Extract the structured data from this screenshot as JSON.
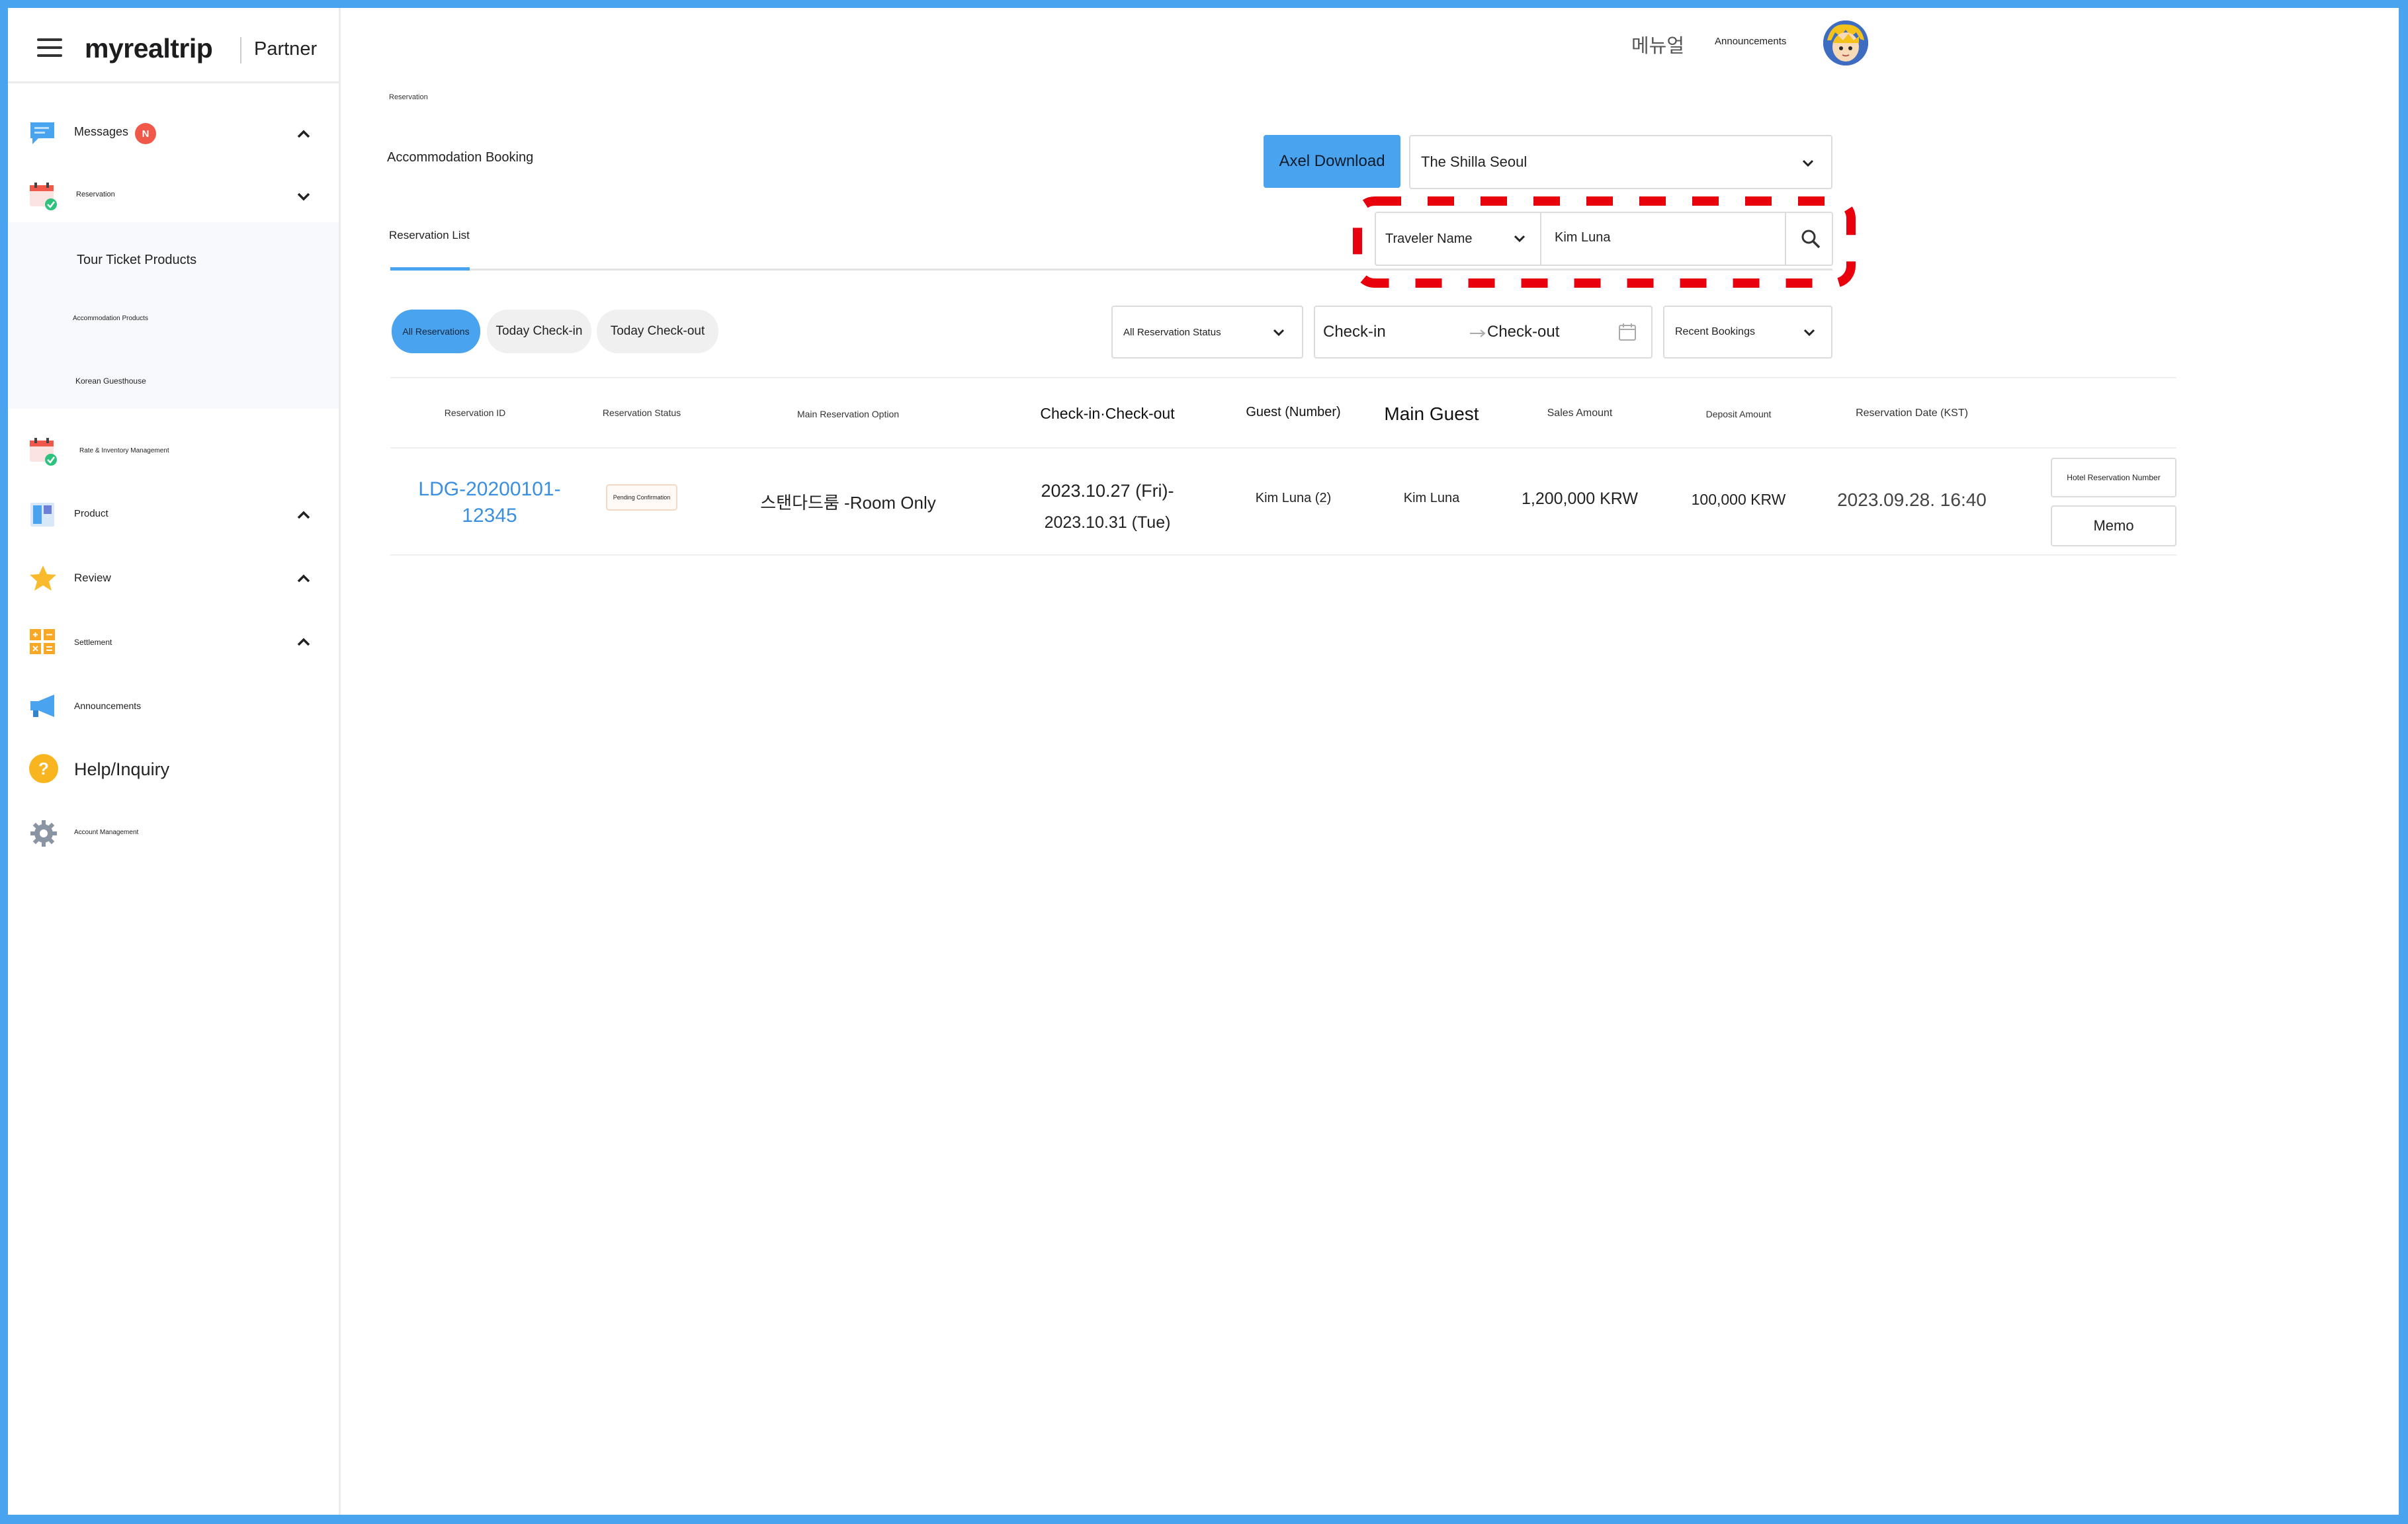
{
  "brand": {
    "logo": "myrealtrip",
    "section": "Partner"
  },
  "topbar": {
    "user_name": "메뉴얼",
    "announcements": "Announcements"
  },
  "sidebar": {
    "items": [
      {
        "label": "Messages",
        "badge": "N"
      },
      {
        "label": "Reservation"
      },
      {
        "label": "Rate & Inventory Management"
      },
      {
        "label": "Product"
      },
      {
        "label": "Review"
      },
      {
        "label": "Settlement"
      },
      {
        "label": "Announcements"
      },
      {
        "label": "Help/Inquiry"
      },
      {
        "label": "Account Management"
      }
    ],
    "submenu": [
      "Tour Ticket Products",
      "Accommodation Products",
      "Korean Guesthouse"
    ]
  },
  "page": {
    "breadcrumb": "Reservation",
    "title": "Accommodation Booking",
    "download_button": "Axel Download",
    "property_select": "The Shilla Seoul",
    "tab_label": "Reservation List",
    "search": {
      "field": "Traveler Name",
      "value": "Kim Luna"
    }
  },
  "filters": {
    "pills": [
      "All Reservations",
      "Today Check-in",
      "Today Check-out"
    ],
    "status_select": "All Reservation Status",
    "checkin_placeholder": "Check-in",
    "checkout_placeholder": "Check-out",
    "sort_select": "Recent Bookings"
  },
  "table": {
    "headers": [
      "Reservation ID",
      "Reservation Status",
      "Main Reservation Option",
      "Check-in·Check-out",
      "Guest (Number)",
      "Main Guest",
      "Sales Amount",
      "Deposit Amount",
      "Reservation Date (KST)"
    ],
    "rows": [
      {
        "id_line1": "LDG-20200101-",
        "id_line2": "12345",
        "status": "Pending Confirmation",
        "option": "스탠다드룸 -Room Only",
        "checkin": "2023.10.27 (Fri)-",
        "checkout": "2023.10.31 (Tue)",
        "guests": "Kim Luna (2)",
        "main_guest": "Kim Luna",
        "sales": "1,200,000 KRW",
        "deposit": "100,000 KRW",
        "date": "2023.09.28. 16:40",
        "action_hotel": "Hotel Reservation Number",
        "action_memo": "Memo"
      }
    ]
  },
  "colors": {
    "accent": "#4aa3ee",
    "highlight": "#e8000d",
    "badge": "#f0584a",
    "link": "#3a8fe0"
  }
}
